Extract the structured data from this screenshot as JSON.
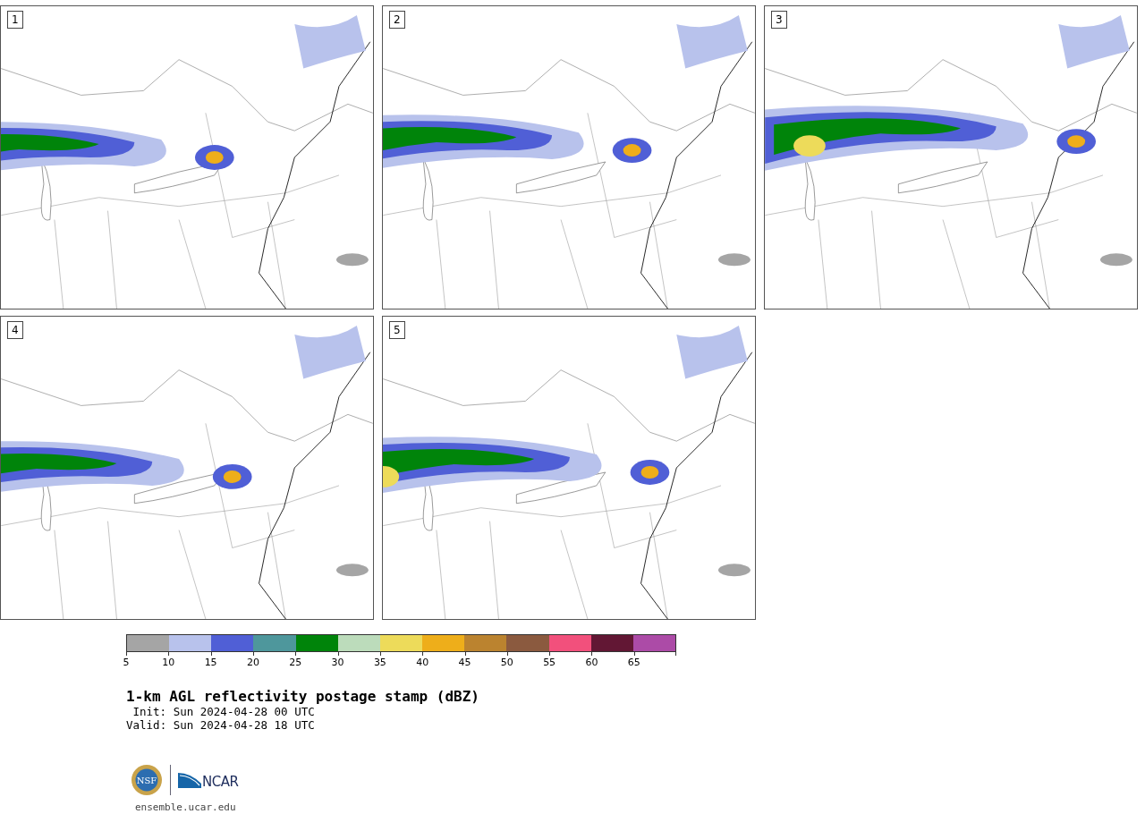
{
  "panels": [
    {
      "label": "1"
    },
    {
      "label": "2"
    },
    {
      "label": "3"
    },
    {
      "label": "4"
    },
    {
      "label": "5"
    }
  ],
  "colorbar": {
    "bins": [
      {
        "label": "5",
        "color": "#a5a5a5"
      },
      {
        "label": "10",
        "color": "#b8c2ec"
      },
      {
        "label": "15",
        "color": "#505fd6"
      },
      {
        "label": "20",
        "color": "#4e979c"
      },
      {
        "label": "25",
        "color": "#00840a"
      },
      {
        "label": "30",
        "color": "#bcdcbb"
      },
      {
        "label": "35",
        "color": "#eddb5a"
      },
      {
        "label": "40",
        "color": "#eeae1a"
      },
      {
        "label": "45",
        "color": "#bb832f"
      },
      {
        "label": "50",
        "color": "#8b5a3f"
      },
      {
        "label": "55",
        "color": "#f2507c"
      },
      {
        "label": "60",
        "color": "#621734"
      },
      {
        "label": "65",
        "color": "#ac4ba7"
      }
    ]
  },
  "title": "1-km AGL reflectivity postage stamp (dBZ)",
  "times": [
    {
      "label": "Init:",
      "value": "Sun 2024-04-28 00 UTC"
    },
    {
      "label": "Valid:",
      "value": "Sun 2024-04-28 18 UTC"
    }
  ],
  "logos": {
    "nsf": "NSF",
    "ncar": "NCAR"
  },
  "url": "ensemble.ucar.edu"
}
